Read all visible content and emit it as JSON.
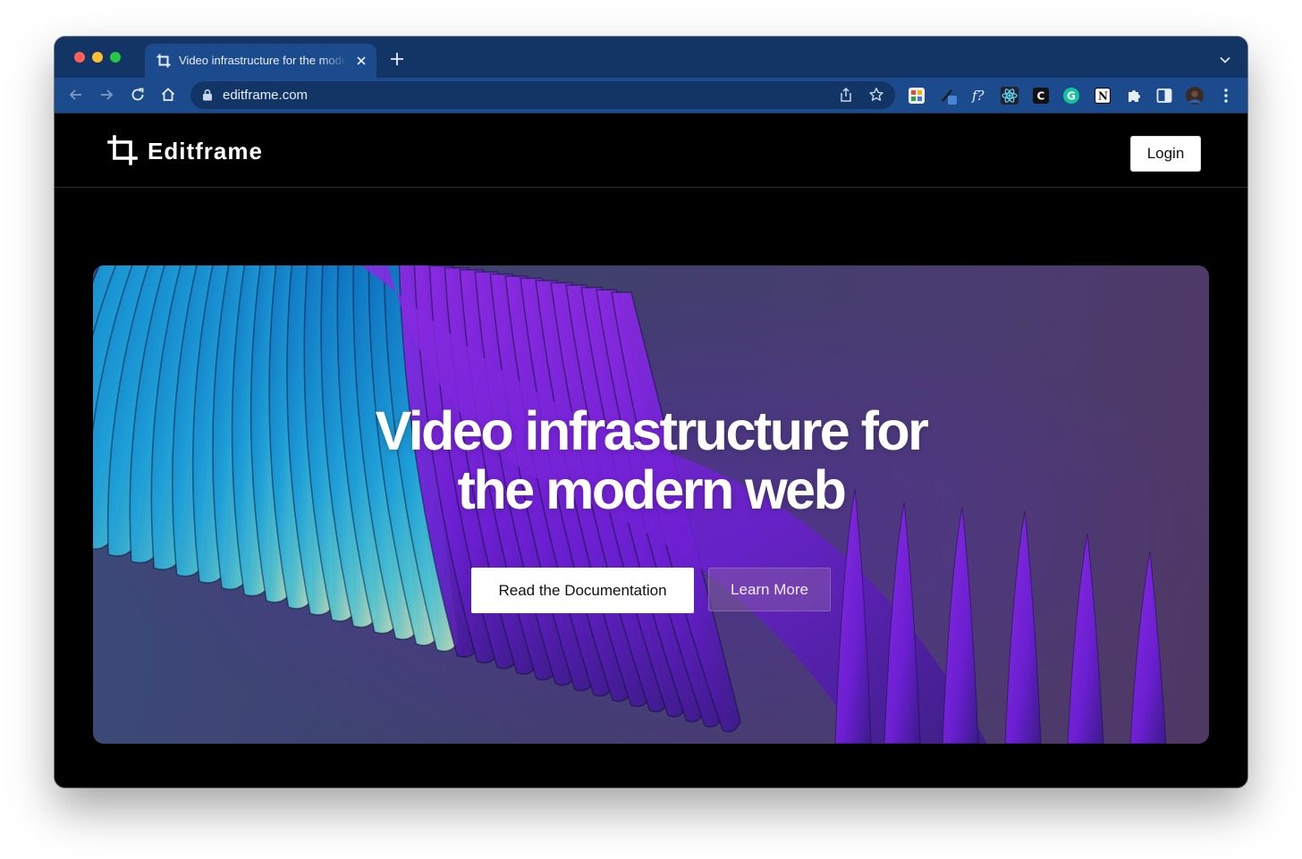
{
  "browser": {
    "tab": {
      "title": "Video infrastructure for the modern web"
    },
    "address_bar": {
      "url": "editframe.com"
    },
    "extensions": [
      "palette-extension-icon",
      "color-picker-extension-icon",
      "formula-extension-icon",
      "react-devtools-icon",
      "c-extension-icon",
      "grammarly-icon",
      "notion-icon",
      "puzzle-extensions-icon",
      "side-panel-icon",
      "profile-avatar"
    ],
    "colors": {
      "tabstrip": "#123566",
      "toolbar": "#1b4b8c"
    }
  },
  "site": {
    "brand": "Editframe",
    "login_label": "Login",
    "hero": {
      "title": "Video infrastructure for the modern web",
      "primary_cta": "Read the Documentation",
      "secondary_cta": "Learn More"
    }
  }
}
